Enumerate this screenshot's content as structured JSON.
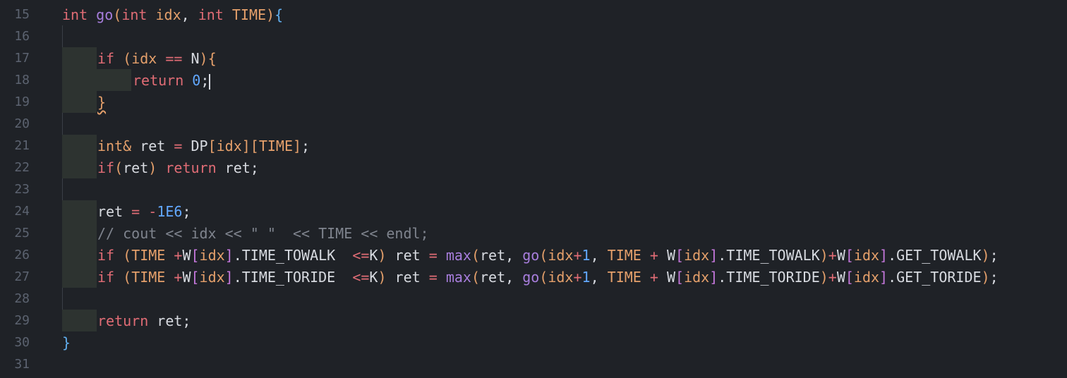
{
  "editor": {
    "lines": [
      {
        "num": "15",
        "code": "int go(int idx, int TIME){"
      },
      {
        "num": "16",
        "code": ""
      },
      {
        "num": "17",
        "code": "if (idx == N){"
      },
      {
        "num": "18",
        "code": "return 0;"
      },
      {
        "num": "19",
        "code": "}"
      },
      {
        "num": "20",
        "code": ""
      },
      {
        "num": "21",
        "code": "int& ret = DP[idx][TIME];"
      },
      {
        "num": "22",
        "code": "if(ret) return ret;"
      },
      {
        "num": "23",
        "code": ""
      },
      {
        "num": "24",
        "code": "ret = -1E6;"
      },
      {
        "num": "25",
        "code": "// cout << idx << \" \"  << TIME << endl;"
      },
      {
        "num": "26",
        "code": "if (TIME +W[idx].TIME_TOWALK  <=K) ret = max(ret, go(idx+1, TIME + W[idx].TIME_TOWALK)+W[idx].GET_TOWALK);"
      },
      {
        "num": "27",
        "code": "if (TIME +W[idx].TIME_TORIDE  <=K) ret = max(ret, go(idx+1, TIME + W[idx].TIME_TORIDE)+W[idx].GET_TORIDE);"
      },
      {
        "num": "28",
        "code": ""
      },
      {
        "num": "29",
        "code": "return ret;"
      },
      {
        "num": "30",
        "code": "}"
      },
      {
        "num": "31",
        "code": ""
      }
    ]
  },
  "theme": {
    "background": "#1f2227",
    "keyword": "#e06c75",
    "type": "#e5a06b",
    "function": "#a87edd",
    "number": "#62a8ff",
    "comment": "#7f848e"
  }
}
